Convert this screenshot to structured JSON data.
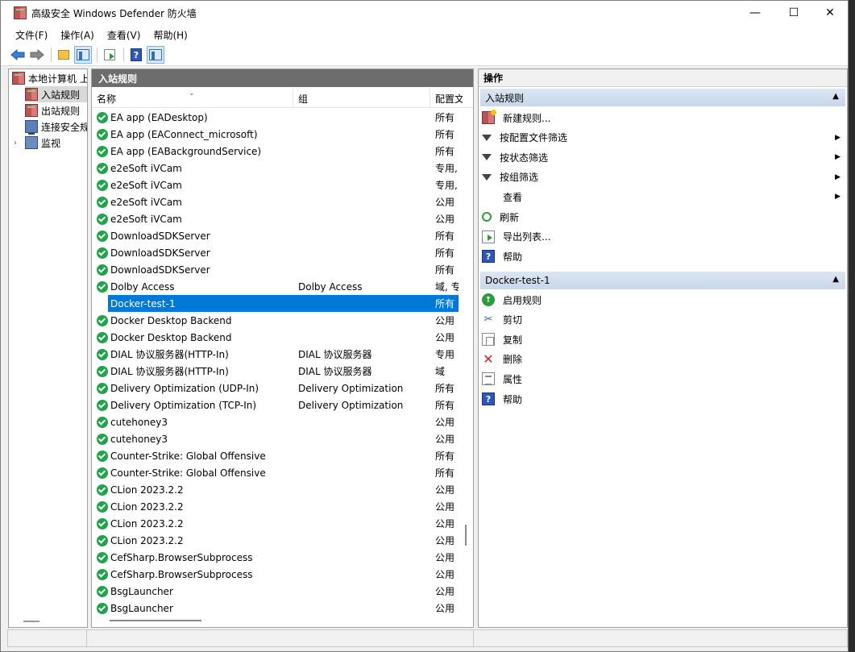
{
  "window": {
    "title": "高级安全 Windows Defender 防火墙",
    "minimize": "—",
    "maximize": "☐",
    "close": "✕"
  },
  "menu": [
    "文件(F)",
    "操作(A)",
    "查看(V)",
    "帮助(H)"
  ],
  "toolbar_icons": [
    "back-icon",
    "forward-icon",
    "up-folder-icon",
    "show-hide-pane-icon",
    "export-icon",
    "help-icon",
    "show-action-pane-icon"
  ],
  "tree": {
    "root": "本地计算机 上",
    "items": [
      "入站规则",
      "出站规则",
      "连接安全规",
      "监视"
    ]
  },
  "center": {
    "header": "入站规则",
    "columns": {
      "name": "名称",
      "group": "组",
      "profile": "配置文"
    },
    "rows": [
      {
        "name": "EA app (EADesktop)",
        "group": "",
        "profile": "所有",
        "enabled": true
      },
      {
        "name": "EA app (EAConnect_microsoft)",
        "group": "",
        "profile": "所有",
        "enabled": true
      },
      {
        "name": "EA app (EABackgroundService)",
        "group": "",
        "profile": "所有",
        "enabled": true
      },
      {
        "name": "e2eSoft iVCam",
        "group": "",
        "profile": "专用,",
        "enabled": true
      },
      {
        "name": "e2eSoft iVCam",
        "group": "",
        "profile": "专用,",
        "enabled": true
      },
      {
        "name": "e2eSoft iVCam",
        "group": "",
        "profile": "公用",
        "enabled": true
      },
      {
        "name": "e2eSoft iVCam",
        "group": "",
        "profile": "公用",
        "enabled": true
      },
      {
        "name": "DownloadSDKServer",
        "group": "",
        "profile": "所有",
        "enabled": true
      },
      {
        "name": "DownloadSDKServer",
        "group": "",
        "profile": "所有",
        "enabled": true
      },
      {
        "name": "DownloadSDKServer",
        "group": "",
        "profile": "所有",
        "enabled": true
      },
      {
        "name": "Dolby Access",
        "group": "Dolby Access",
        "profile": "域, 专",
        "enabled": true
      },
      {
        "name": "Docker-test-1",
        "group": "",
        "profile": "所有",
        "enabled": false,
        "selected": true
      },
      {
        "name": "Docker Desktop Backend",
        "group": "",
        "profile": "公用",
        "enabled": true
      },
      {
        "name": "Docker Desktop Backend",
        "group": "",
        "profile": "公用",
        "enabled": true
      },
      {
        "name": "DIAL 协议服务器(HTTP-In)",
        "group": "DIAL 协议服务器",
        "profile": "专用",
        "enabled": true
      },
      {
        "name": "DIAL 协议服务器(HTTP-In)",
        "group": "DIAL 协议服务器",
        "profile": "域",
        "enabled": true
      },
      {
        "name": "Delivery Optimization (UDP-In)",
        "group": "Delivery Optimization",
        "profile": "所有",
        "enabled": true
      },
      {
        "name": "Delivery Optimization (TCP-In)",
        "group": "Delivery Optimization",
        "profile": "所有",
        "enabled": true
      },
      {
        "name": "cutehoney3",
        "group": "",
        "profile": "公用",
        "enabled": true
      },
      {
        "name": "cutehoney3",
        "group": "",
        "profile": "公用",
        "enabled": true
      },
      {
        "name": "Counter-Strike: Global Offensive",
        "group": "",
        "profile": "所有",
        "enabled": true
      },
      {
        "name": "Counter-Strike: Global Offensive",
        "group": "",
        "profile": "所有",
        "enabled": true
      },
      {
        "name": "CLion 2023.2.2",
        "group": "",
        "profile": "公用",
        "enabled": true
      },
      {
        "name": "CLion 2023.2.2",
        "group": "",
        "profile": "公用",
        "enabled": true
      },
      {
        "name": "CLion 2023.2.2",
        "group": "",
        "profile": "公用",
        "enabled": true
      },
      {
        "name": "CLion 2023.2.2",
        "group": "",
        "profile": "公用",
        "enabled": true
      },
      {
        "name": "CefSharp.BrowserSubprocess",
        "group": "",
        "profile": "公用",
        "enabled": true
      },
      {
        "name": "CefSharp.BrowserSubprocess",
        "group": "",
        "profile": "公用",
        "enabled": true
      },
      {
        "name": "BsgLauncher",
        "group": "",
        "profile": "公用",
        "enabled": true
      },
      {
        "name": "BsgLauncher",
        "group": "",
        "profile": "公用",
        "enabled": true
      }
    ]
  },
  "actions": {
    "header": "操作",
    "section1": {
      "title": "入站规则",
      "items": [
        {
          "label": "新建规则...",
          "icon": "new-rule-icon",
          "submenu": false
        },
        {
          "label": "按配置文件筛选",
          "icon": "filter-icon",
          "submenu": true
        },
        {
          "label": "按状态筛选",
          "icon": "filter-icon",
          "submenu": true
        },
        {
          "label": "按组筛选",
          "icon": "filter-icon",
          "submenu": true
        },
        {
          "label": "查看",
          "icon": "",
          "submenu": true
        },
        {
          "label": "刷新",
          "icon": "refresh-icon",
          "submenu": false
        },
        {
          "label": "导出列表...",
          "icon": "export-icon",
          "submenu": false
        },
        {
          "label": "帮助",
          "icon": "help-icon",
          "submenu": false
        }
      ]
    },
    "section2": {
      "title": "Docker-test-1",
      "items": [
        {
          "label": "启用规则",
          "icon": "enable-icon"
        },
        {
          "label": "剪切",
          "icon": "cut-icon"
        },
        {
          "label": "复制",
          "icon": "copy-icon"
        },
        {
          "label": "删除",
          "icon": "delete-icon"
        },
        {
          "label": "属性",
          "icon": "properties-icon"
        },
        {
          "label": "帮助",
          "icon": "help-icon"
        }
      ]
    }
  }
}
